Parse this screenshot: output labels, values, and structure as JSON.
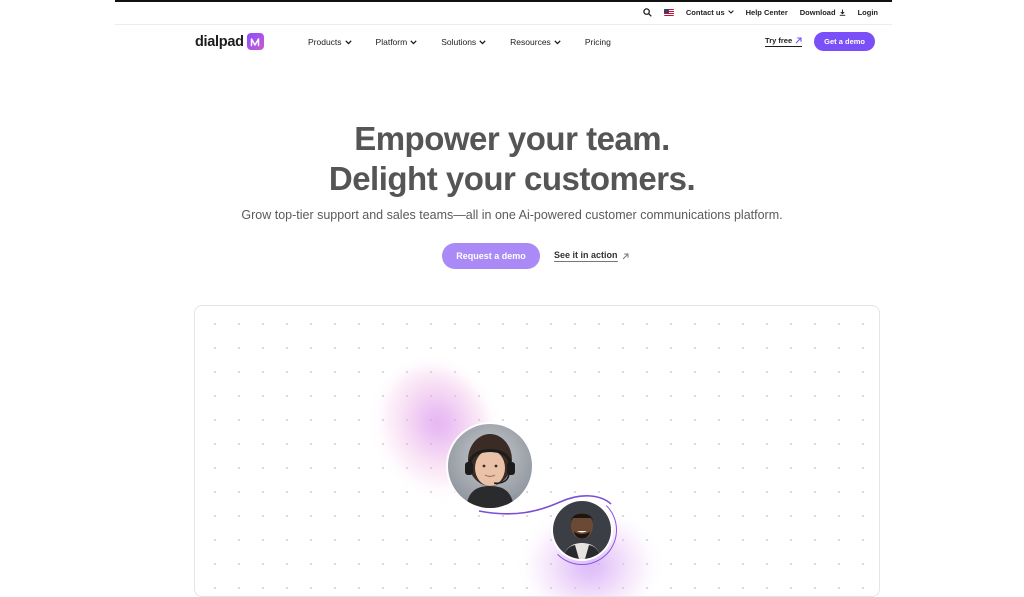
{
  "utility_bar": {
    "search_icon": "search-icon",
    "flag_icon": "us-flag-icon",
    "contact_label": "Contact us",
    "help_label": "Help Center",
    "download_label": "Download",
    "login_label": "Login"
  },
  "nav": {
    "logo_text": "dialpad",
    "items": [
      {
        "label": "Products"
      },
      {
        "label": "Platform"
      },
      {
        "label": "Solutions"
      },
      {
        "label": "Resources"
      },
      {
        "label": "Pricing"
      }
    ],
    "try_free_label": "Try free",
    "demo_label": "Get a demo"
  },
  "hero": {
    "title_line1": "Empower your team.",
    "title_line2": "Delight your customers.",
    "subtitle": "Grow top-tier support and sales teams—all in one Ai-powered customer communications platform.",
    "primary_cta": "Request a demo",
    "secondary_cta": "See it in action"
  },
  "colors": {
    "brand_purple": "#7b4ff7",
    "cta_purple": "#a98af7",
    "heading_gray": "#555555"
  }
}
